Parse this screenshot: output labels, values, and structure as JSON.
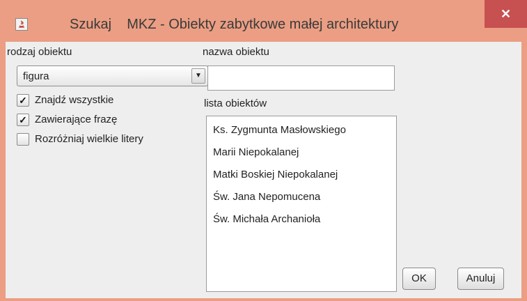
{
  "window": {
    "title": "Szukaj    MKZ - Obiekty zabytkowe małej architektury",
    "close_symbol": "✕"
  },
  "left": {
    "object_type_label": "rodzaj obiektu",
    "object_type_selected": "figura",
    "dropdown_arrow": "▼",
    "options": [
      {
        "label": "Znajdź wszystkie",
        "checked": true
      },
      {
        "label": "Zawierające frazę",
        "checked": true
      },
      {
        "label": "Rozróżniaj wielkie litery",
        "checked": false
      }
    ]
  },
  "right": {
    "object_name_label": "nazwa obiektu",
    "object_name_value": "",
    "list_label": "lista obiektów",
    "list_items": [
      "Ks. Zygmunta Masłowskiego",
      "Marii Niepokalanej",
      "Matki Boskiej Niepokalanej",
      "Św. Jana Nepomucena",
      "Św. Michała Archanioła"
    ]
  },
  "buttons": {
    "ok": "OK",
    "cancel": "Anuluj"
  },
  "colors": {
    "title_bar": "#eb9e83",
    "close_button": "#c75050",
    "client_bg": "#eeeeee"
  },
  "icons": {
    "app": "java-icon",
    "close": "close-icon",
    "check": "checkmark-icon"
  }
}
